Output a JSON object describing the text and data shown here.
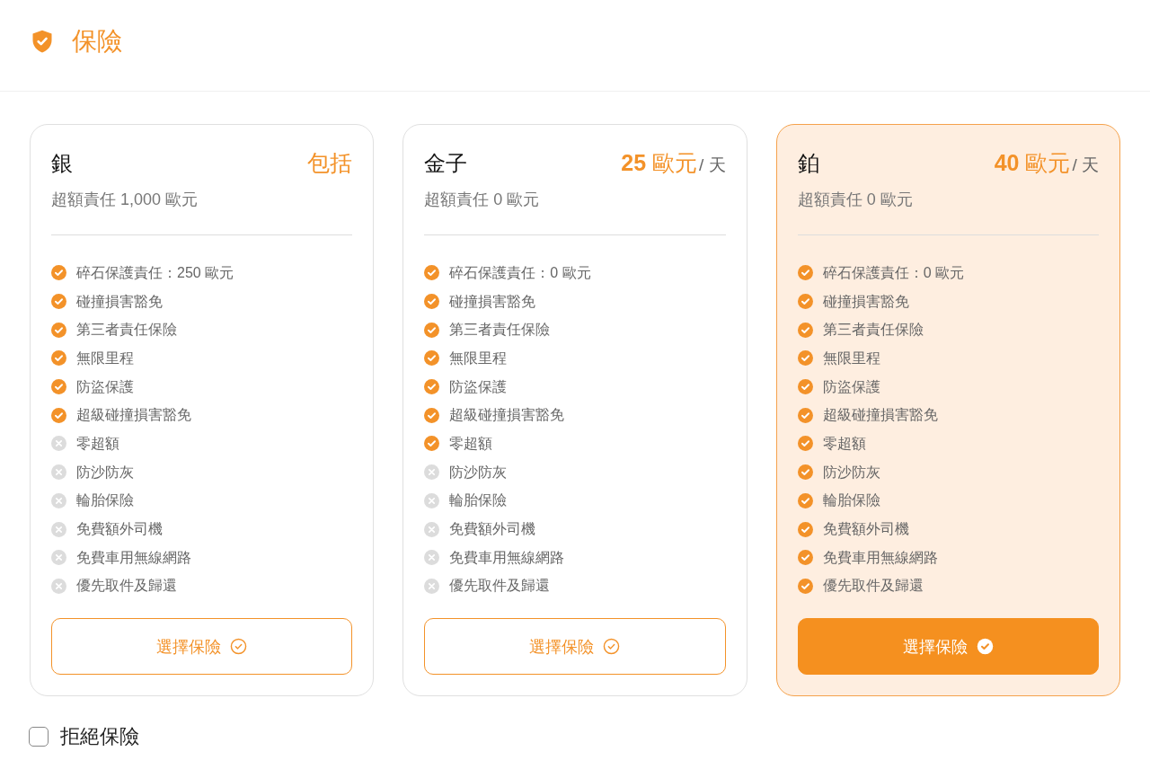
{
  "header": {
    "title": "保險"
  },
  "plans": [
    {
      "name": "銀",
      "price": "包括",
      "excess": "超額責任 1,000 歐元",
      "selected": false,
      "features": [
        {
          "label": "碎石保護責任：250 歐元",
          "included": true
        },
        {
          "label": "碰撞損害豁免",
          "included": true
        },
        {
          "label": "第三者責任保險",
          "included": true
        },
        {
          "label": "無限里程",
          "included": true
        },
        {
          "label": "防盜保護",
          "included": true
        },
        {
          "label": "超級碰撞損害豁免",
          "included": true
        },
        {
          "label": "零超額",
          "included": false
        },
        {
          "label": "防沙防灰",
          "included": false
        },
        {
          "label": "輪胎保險",
          "included": false
        },
        {
          "label": "免費額外司機",
          "included": false
        },
        {
          "label": "免費車用無線網路",
          "included": false
        },
        {
          "label": "優先取件及歸還",
          "included": false
        }
      ],
      "button": "選擇保險"
    },
    {
      "name": "金子",
      "price": "**25** 歐元",
      "price_unit": "/ 天",
      "excess": "超額責任 0 歐元",
      "selected": false,
      "features": [
        {
          "label": "碎石保護責任：0 歐元",
          "included": true
        },
        {
          "label": "碰撞損害豁免",
          "included": true
        },
        {
          "label": "第三者責任保險",
          "included": true
        },
        {
          "label": "無限里程",
          "included": true
        },
        {
          "label": "防盜保護",
          "included": true
        },
        {
          "label": "超級碰撞損害豁免",
          "included": true
        },
        {
          "label": "零超額",
          "included": true
        },
        {
          "label": "防沙防灰",
          "included": false
        },
        {
          "label": "輪胎保險",
          "included": false
        },
        {
          "label": "免費額外司機",
          "included": false
        },
        {
          "label": "免費車用無線網路",
          "included": false
        },
        {
          "label": "優先取件及歸還",
          "included": false
        }
      ],
      "button": "選擇保險"
    },
    {
      "name": "鉑",
      "price": "**40** 歐元",
      "price_unit": "/ 天",
      "excess": "超額責任 0 歐元",
      "selected": true,
      "features": [
        {
          "label": "碎石保護責任：0 歐元",
          "included": true
        },
        {
          "label": "碰撞損害豁免",
          "included": true
        },
        {
          "label": "第三者責任保險",
          "included": true
        },
        {
          "label": "無限里程",
          "included": true
        },
        {
          "label": "防盜保護",
          "included": true
        },
        {
          "label": "超級碰撞損害豁免",
          "included": true
        },
        {
          "label": "零超額",
          "included": true
        },
        {
          "label": "防沙防灰",
          "included": true
        },
        {
          "label": "輪胎保險",
          "included": true
        },
        {
          "label": "免費額外司機",
          "included": true
        },
        {
          "label": "免費車用無線網路",
          "included": true
        },
        {
          "label": "優先取件及歸還",
          "included": true
        }
      ],
      "button": "選擇保險"
    }
  ],
  "decline": {
    "label": "拒絕保險",
    "checked": false
  }
}
